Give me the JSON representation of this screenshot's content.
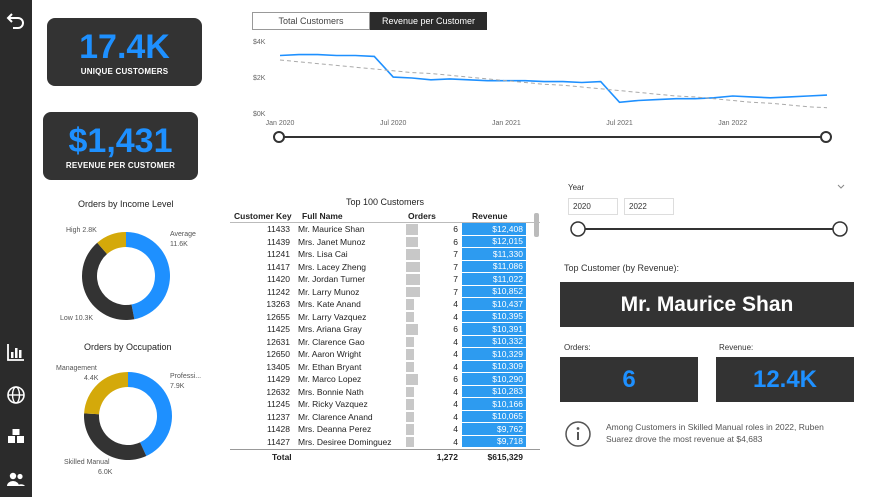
{
  "sidebar": {
    "icons": [
      "back-arrow-icon",
      "bar-chart-icon",
      "globe-icon",
      "boxes-icon",
      "users-icon"
    ]
  },
  "kpis": {
    "unique_customers_value": "17.4K",
    "unique_customers_label": "UNIQUE CUSTOMERS",
    "revenue_per_customer_value": "$1,431",
    "revenue_per_customer_label": "REVENUE PER CUSTOMER"
  },
  "toggle": {
    "total_customers_label": "Total Customers",
    "revenue_per_customer_label": "Revenue per Customer",
    "active": "Revenue per Customer"
  },
  "colors": {
    "accent": "#1e90ff",
    "dark_panel": "#333333",
    "gold": "#d4a90a",
    "sidebar": "#2b2b2b"
  },
  "chart_data": {
    "type": "line",
    "y_ticks": [
      "$4K",
      "$2K",
      "$0K"
    ],
    "x_ticks": [
      "Jan 2020",
      "Jul 2020",
      "Jan 2021",
      "Jul 2021",
      "Jan 2022"
    ],
    "ylim": [
      0,
      4000
    ],
    "x": [
      "2020-01",
      "2020-02",
      "2020-03",
      "2020-04",
      "2020-05",
      "2020-06",
      "2020-07",
      "2020-08",
      "2020-09",
      "2020-10",
      "2020-11",
      "2020-12",
      "2021-01",
      "2021-02",
      "2021-03",
      "2021-04",
      "2021-05",
      "2021-06",
      "2021-07",
      "2021-08",
      "2021-09",
      "2021-10",
      "2021-11",
      "2021-12",
      "2022-01",
      "2022-02",
      "2022-03",
      "2022-04",
      "2022-05",
      "2022-06"
    ],
    "series": [
      {
        "values": [
          3250,
          3300,
          3300,
          3250,
          3250,
          3200,
          2050,
          2000,
          1900,
          1950,
          1900,
          1850,
          1850,
          1850,
          1800,
          1800,
          1750,
          1800,
          650,
          750,
          800,
          850,
          850,
          900,
          1000,
          950,
          900,
          950,
          1000,
          1050
        ],
        "color": "#1e90ff"
      },
      {
        "values": [
          3000,
          2900,
          2800,
          2700,
          2600,
          2500,
          2400,
          2300,
          2250,
          2150,
          2050,
          1950,
          1850,
          1750,
          1650,
          1600,
          1500,
          1400,
          1300,
          1200,
          1100,
          1000,
          950,
          850,
          750,
          650,
          600,
          500,
          400,
          350
        ],
        "color": "#aaaaaa",
        "dashed": true
      }
    ]
  },
  "income_donut": {
    "title": "Orders by Income Level",
    "slices": [
      {
        "label": "Average",
        "value_label": "11.6K",
        "value": 11.6,
        "color": "#1e90ff"
      },
      {
        "label": "Low",
        "value_label": "10.3K",
        "value": 10.3,
        "color": "#333333"
      },
      {
        "label": "High",
        "value_label": "2.8K",
        "value": 2.8,
        "color": "#d4a90a"
      }
    ]
  },
  "occupation_donut": {
    "title": "Orders by Occupation",
    "slices": [
      {
        "label": "Professi...",
        "value_label": "7.9K",
        "value": 7.9,
        "color": "#1e90ff"
      },
      {
        "label": "Skilled Manual",
        "value_label": "6.0K",
        "value": 6.0,
        "color": "#333333"
      },
      {
        "label": "Management",
        "value_label": "4.4K",
        "value": 4.4,
        "color": "#d4a90a"
      }
    ]
  },
  "table": {
    "title": "Top 100 Customers",
    "headers": {
      "key": "Customer Key",
      "name": "Full Name",
      "orders": "Orders",
      "revenue": "Revenue"
    },
    "rows": [
      {
        "key": "11433",
        "name": "Mr. Maurice Shan",
        "orders": "6",
        "revenue": "$12,408"
      },
      {
        "key": "11439",
        "name": "Mrs. Janet Munoz",
        "orders": "6",
        "revenue": "$12,015"
      },
      {
        "key": "11241",
        "name": "Mrs. Lisa Cai",
        "orders": "7",
        "revenue": "$11,330"
      },
      {
        "key": "11417",
        "name": "Mrs. Lacey Zheng",
        "orders": "7",
        "revenue": "$11,086"
      },
      {
        "key": "11420",
        "name": "Mr. Jordan Turner",
        "orders": "7",
        "revenue": "$11,022"
      },
      {
        "key": "11242",
        "name": "Mr. Larry Munoz",
        "orders": "7",
        "revenue": "$10,852"
      },
      {
        "key": "13263",
        "name": "Mrs. Kate Anand",
        "orders": "4",
        "revenue": "$10,437"
      },
      {
        "key": "12655",
        "name": "Mr. Larry Vazquez",
        "orders": "4",
        "revenue": "$10,395"
      },
      {
        "key": "11425",
        "name": "Mrs. Ariana Gray",
        "orders": "6",
        "revenue": "$10,391"
      },
      {
        "key": "12631",
        "name": "Mr. Clarence Gao",
        "orders": "4",
        "revenue": "$10,332"
      },
      {
        "key": "12650",
        "name": "Mr. Aaron Wright",
        "orders": "4",
        "revenue": "$10,329"
      },
      {
        "key": "13405",
        "name": "Mr. Ethan Bryant",
        "orders": "4",
        "revenue": "$10,309"
      },
      {
        "key": "11429",
        "name": "Mr. Marco Lopez",
        "orders": "6",
        "revenue": "$10,290"
      },
      {
        "key": "12632",
        "name": "Mrs. Bonnie Nath",
        "orders": "4",
        "revenue": "$10,283"
      },
      {
        "key": "11245",
        "name": "Mr. Ricky Vazquez",
        "orders": "4",
        "revenue": "$10,166"
      },
      {
        "key": "11237",
        "name": "Mr. Clarence Anand",
        "orders": "4",
        "revenue": "$10,065"
      },
      {
        "key": "11428",
        "name": "Mrs. Deanna Perez",
        "orders": "4",
        "revenue": "$9,762"
      },
      {
        "key": "11427",
        "name": "Mrs. Desiree Dominguez",
        "orders": "4",
        "revenue": "$9,718"
      }
    ],
    "total_label": "Total",
    "total_orders": "1,272",
    "total_revenue": "$615,329"
  },
  "year_slicer": {
    "label": "Year",
    "start": "2020",
    "end": "2022"
  },
  "top_customer": {
    "label": "Top Customer (by Revenue):",
    "name": "Mr. Maurice Shan",
    "orders_label": "Orders:",
    "orders_value": "6",
    "revenue_label": "Revenue:",
    "revenue_value": "12.4K"
  },
  "insight": {
    "text": "Among Customers in Skilled Manual roles in 2022, Ruben Suarez drove the most revenue at $4,683"
  }
}
